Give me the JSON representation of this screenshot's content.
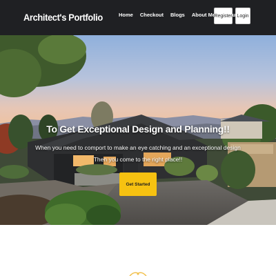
{
  "navbar": {
    "brand": "Architect's Portfolio",
    "links": [
      "Home",
      "Checkout",
      "Blogs",
      "About Me",
      "About Me"
    ],
    "register_label": "Register",
    "login_label": "Login"
  },
  "hero": {
    "title": "To Get Exceptional Design and Planning!!",
    "subtitle_line1": "When you need to comport to make an eye catching and an exceptional design",
    "subtitle_line2": "Then you come to the right place!!",
    "cta_label": "Get Started"
  },
  "colors": {
    "navbar_bg": "#1f2023",
    "cta_bg": "#f6c211",
    "accent_icon": "#f2c14e"
  },
  "icons": [
    "peek-decorative-icon"
  ]
}
